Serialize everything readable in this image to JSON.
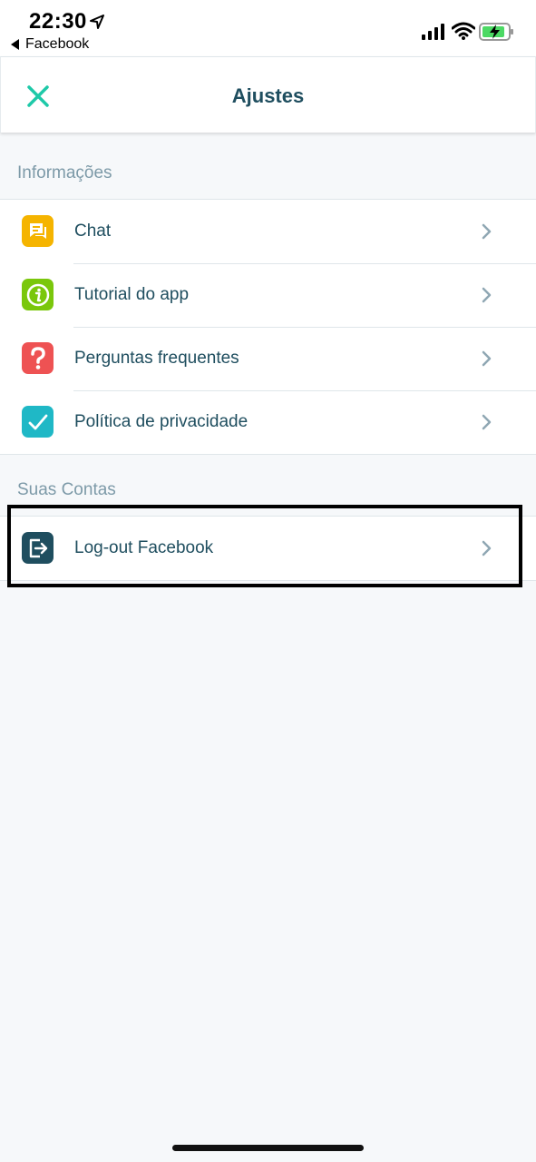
{
  "status_bar": {
    "time": "22:30",
    "back_app": "Facebook"
  },
  "header": {
    "title": "Ajustes"
  },
  "sections": [
    {
      "title": "Informações",
      "items": [
        {
          "label": "Chat",
          "icon": "chat-icon",
          "color": "#f5b400"
        },
        {
          "label": "Tutorial do app",
          "icon": "info-icon",
          "color": "#7ac70c"
        },
        {
          "label": "Perguntas frequentes",
          "icon": "question-icon",
          "color": "#ee5253"
        },
        {
          "label": "Política de privacidade",
          "icon": "checkmark-icon",
          "color": "#1fb8c6"
        }
      ]
    },
    {
      "title": "Suas Contas",
      "items": [
        {
          "label": "Log-out Facebook",
          "icon": "logout-icon",
          "color": "#1f4e5f"
        }
      ]
    }
  ],
  "colors": {
    "accent": "#1ec9a8",
    "text": "#1f4e5f",
    "section_title": "#7d9aa8",
    "background": "#f6f8fa"
  }
}
